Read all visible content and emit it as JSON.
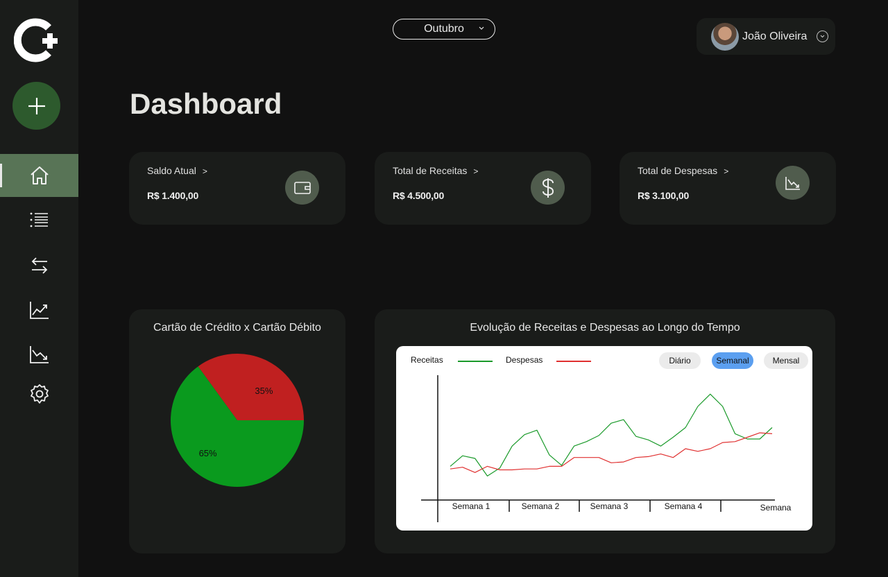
{
  "header": {
    "month_select": "Outubro",
    "user_name": "João Oliveira"
  },
  "page": {
    "title": "Dashboard"
  },
  "cards": [
    {
      "label": "Saldo Atual",
      "value": "R$ 1.400,00",
      "icon": "wallet-icon"
    },
    {
      "label": "Total de Receitas",
      "value": "R$ 4.500,00",
      "icon": "dollar-icon"
    },
    {
      "label": "Total de Despesas",
      "value": "R$ 3.100,00",
      "icon": "trend-down-icon"
    }
  ],
  "card_arrow": ">",
  "sidebar": {
    "items": [
      {
        "icon": "home-icon"
      },
      {
        "icon": "list-icon"
      },
      {
        "icon": "transfer-icon"
      },
      {
        "icon": "chart-up-icon"
      },
      {
        "icon": "chart-down-icon"
      },
      {
        "icon": "settings-icon"
      }
    ]
  },
  "colors": {
    "accent": "#587456",
    "income": "#0a9a1e",
    "expense": "#c02020"
  },
  "chart_data": [
    {
      "type": "pie",
      "title": "Cartão de Crédito x Cartão Débito",
      "slices": [
        {
          "label": "35%",
          "value": 35,
          "color": "#c02020"
        },
        {
          "label": "65%",
          "value": 65,
          "color": "#0a9a1e"
        }
      ]
    },
    {
      "type": "line",
      "title": "Evolução de Receitas e Despesas ao Longo do Tempo",
      "categories": [
        "Semana 1",
        "Semana 2",
        "Semana 3",
        "Semana 4"
      ],
      "xlabel": "Semana",
      "filters": [
        "Diário",
        "Semanal",
        "Mensal"
      ],
      "selected_filter": "Semanal",
      "ylim": [
        0,
        100
      ],
      "series": [
        {
          "name": "Receitas",
          "color": "#1a9a2a",
          "values": [
            17,
            29,
            26,
            6,
            15,
            40,
            53,
            58,
            30,
            18,
            40,
            45,
            52,
            66,
            70,
            51,
            47,
            40,
            50,
            61,
            85,
            99,
            85,
            54,
            48,
            48,
            61
          ]
        },
        {
          "name": "Despesas",
          "color": "#e03030",
          "values": [
            14,
            16,
            10,
            17,
            13,
            13,
            14,
            14,
            17,
            17,
            27,
            27,
            27,
            21,
            22,
            27,
            28,
            31,
            27,
            37,
            34,
            37,
            44,
            45,
            50,
            55,
            54
          ]
        }
      ]
    }
  ]
}
